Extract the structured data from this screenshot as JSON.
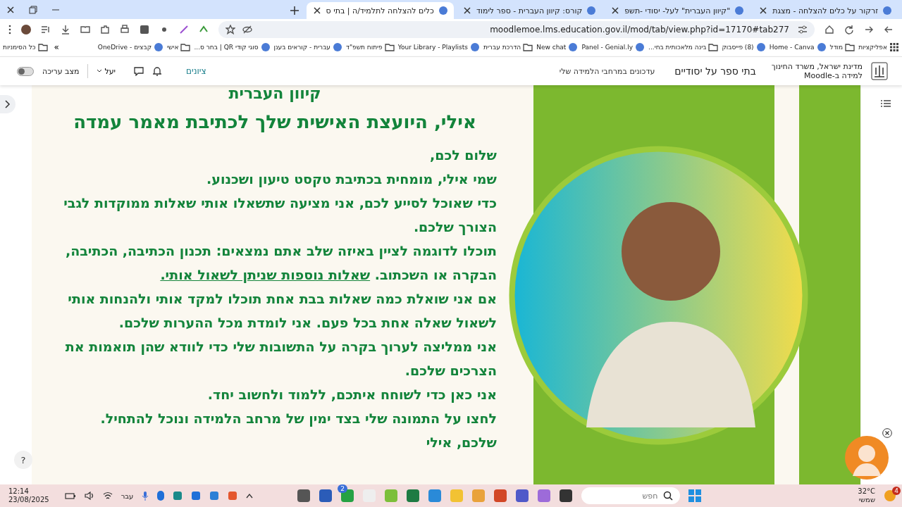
{
  "browser": {
    "tabs": [
      {
        "title": "זרקור על כלים להצלחה - מצגת",
        "selected": false
      },
      {
        "title": "\"קיוון העברית\" לעל- יסודי -תשפ",
        "selected": false
      },
      {
        "title": "קורס: קיוון העברית - ספר לימוד",
        "selected": false
      },
      {
        "title": "כלים להצלחה לתלמיד/ה | בתי ס",
        "selected": true
      }
    ],
    "address": "moodlemoe.lms.education.gov.il/mod/tab/view.php?id=17170#tab277",
    "bookmarks": [
      {
        "label": "אפליקציות",
        "kind": "apps"
      },
      {
        "label": "מודל",
        "kind": "folder"
      },
      {
        "label": "Home - Canva",
        "kind": "site"
      },
      {
        "label": "(8) פייסבוק",
        "kind": "site"
      },
      {
        "label": "בינה מלאכותית בחי...",
        "kind": "folder"
      },
      {
        "label": "Panel - Genial.ly",
        "kind": "site"
      },
      {
        "label": "New chat",
        "kind": "site"
      },
      {
        "label": "הדרכת עברית",
        "kind": "folder"
      },
      {
        "label": "Your Library - Playlists",
        "kind": "site"
      },
      {
        "label": "פיתוח תשפ\"ד",
        "kind": "folder"
      },
      {
        "label": "עברית - קוראים בענן",
        "kind": "site"
      },
      {
        "label": "סוגי קודי QR | בחר ס...",
        "kind": "site"
      },
      {
        "label": "אישי",
        "kind": "folder"
      },
      {
        "label": "קבצים - OneDrive",
        "kind": "site"
      }
    ],
    "more_bookmarks": "»",
    "all_bookmarks": "כל הסימניות"
  },
  "moodle": {
    "org_line1": "מדינת ישראל, משרד החינוך",
    "org_line2": "למידה ב-Moodle",
    "site_name": "בתי ספר על יסודיים",
    "nav_link": "עדכונים במרחבי הלמידה שלי",
    "grades": "ציונים",
    "user": "יעל",
    "edit_mode": {
      "label": "מצב עריכה",
      "on": false
    }
  },
  "banner": {
    "subtitle": "קיוון העברית",
    "title": "אילי, היועצת האישית שלך לכתיבת מאמר עמדה",
    "paragraphs": [
      {
        "text": "שלום לכם,"
      },
      {
        "text": "שמי אילי, מומחית בכתיבת טקסט טיעון ושכנוע."
      },
      {
        "text": "כדי שאוכל לסייע לכם, אני מציעה שתשאלו אותי שאלות ממוקדות לגבי הצורך שלכם."
      },
      {
        "text": "תוכלו לדוגמה לציין באיזה שלב אתם נמצאים: תכנון הכתיבה, הכתיבה, הבקרה או השכתוב.",
        "link": "שאלות נוספות שניתן לשאול אותי."
      },
      {
        "text": "אם אני שואלת כמה שאלות בבת אחת תוכלו למקד אותי ולהנחות אותי לשאול שאלה אחת בכל פעם. אני לומדת מכל ההערות שלכם."
      },
      {
        "text": "אני ממליצה לערוך בקרה על התשובות שלי כדי לוודא שהן תואמות את הצרכים שלכם."
      },
      {
        "text": "אני כאן כדי לשוחח איתכם, ללמוד ולחשוב יחד."
      },
      {
        "text": "לחצו על התמונה שלי בצד ימין של מרחב הלמידה ונוכל להתחיל."
      },
      {
        "text": "שלכם, אילי"
      }
    ]
  },
  "help": "?",
  "taskbar": {
    "time": "12:14",
    "date": "23/08/2025",
    "language": "עבר",
    "chat_badge": "2",
    "search_placeholder": "חפש",
    "weather_temp": "32°C",
    "weather_text": "שמשי",
    "notification_badge": "4"
  }
}
